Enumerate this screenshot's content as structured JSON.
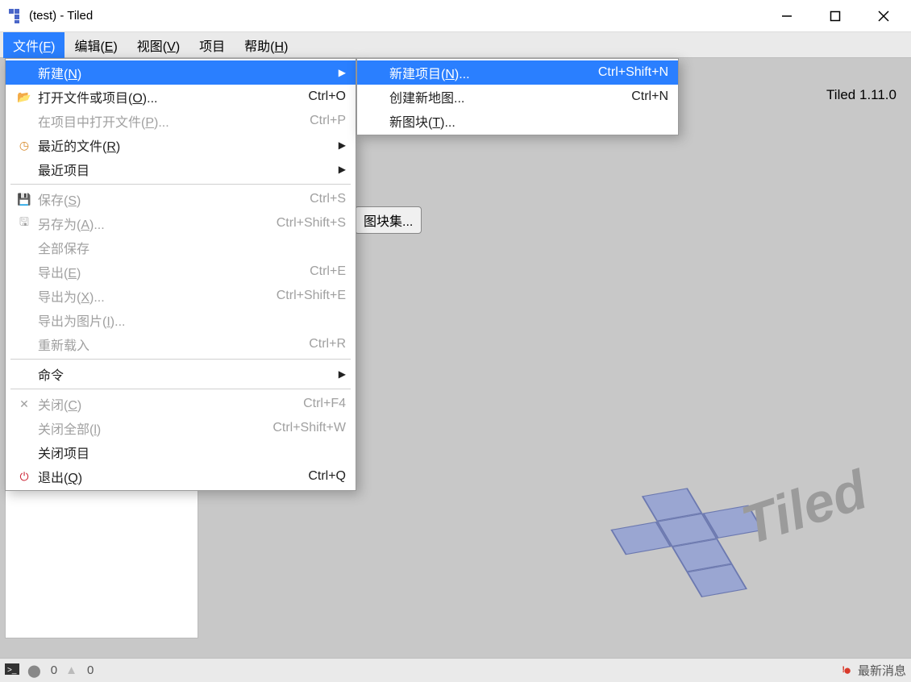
{
  "title": "(test) - Tiled",
  "version": "Tiled 1.11.0",
  "menubar": [
    {
      "label": "文件(",
      "key": "F",
      "tail": ")"
    },
    {
      "label": "编辑(",
      "key": "E",
      "tail": ")"
    },
    {
      "label": "视图(",
      "key": "V",
      "tail": ")"
    },
    {
      "label": "项目",
      "key": "",
      "tail": ""
    },
    {
      "label": "帮助(",
      "key": "H",
      "tail": ")"
    }
  ],
  "center_btn": "图块集...",
  "file_menu": {
    "new": {
      "label": "新建(",
      "key": "N",
      "tail": ")"
    },
    "open": {
      "label": "打开文件或项目(",
      "key": "O",
      "tail": ")...",
      "sc": "Ctrl+O"
    },
    "open_in": {
      "label": "在项目中打开文件(",
      "key": "P",
      "tail": ")...",
      "sc": "Ctrl+P"
    },
    "recent_f": {
      "label": "最近的文件(",
      "key": "R",
      "tail": ")"
    },
    "recent_p": {
      "label": "最近项目"
    },
    "save": {
      "label": "保存(",
      "key": "S",
      "tail": ")",
      "sc": "Ctrl+S"
    },
    "save_as": {
      "label": "另存为(",
      "key": "A",
      "tail": ")...",
      "sc": "Ctrl+Shift+S"
    },
    "save_all": {
      "label": "全部保存"
    },
    "export": {
      "label": "导出(",
      "key": "E",
      "tail": ")",
      "sc": "Ctrl+E"
    },
    "export_as": {
      "label": "导出为(",
      "key": "X",
      "tail": ")...",
      "sc": "Ctrl+Shift+E"
    },
    "export_img": {
      "label": "导出为图片(",
      "key": "I",
      "tail": ")..."
    },
    "reload": {
      "label": "重新载入",
      "sc": "Ctrl+R"
    },
    "commands": {
      "label": "命令"
    },
    "close": {
      "label": "关闭(",
      "key": "C",
      "tail": ")",
      "sc": "Ctrl+F4"
    },
    "close_all": {
      "label": "关闭全部(",
      "key": "l",
      "tail": ")",
      "sc": "Ctrl+Shift+W"
    },
    "close_proj": {
      "label": "关闭项目"
    },
    "quit": {
      "label": "退出(",
      "key": "Q",
      "tail": ")",
      "sc": "Ctrl+Q"
    }
  },
  "sub_menu": {
    "new_project": {
      "label": "新建项目(",
      "key": "N",
      "tail": ")...",
      "sc": "Ctrl+Shift+N"
    },
    "new_map": {
      "label": "创建新地图...",
      "sc": "Ctrl+N"
    },
    "new_tileset": {
      "label": "新图块(",
      "key": "T",
      "tail": ")..."
    }
  },
  "status": {
    "err": "0",
    "warn": "0",
    "news": "最新消息"
  }
}
